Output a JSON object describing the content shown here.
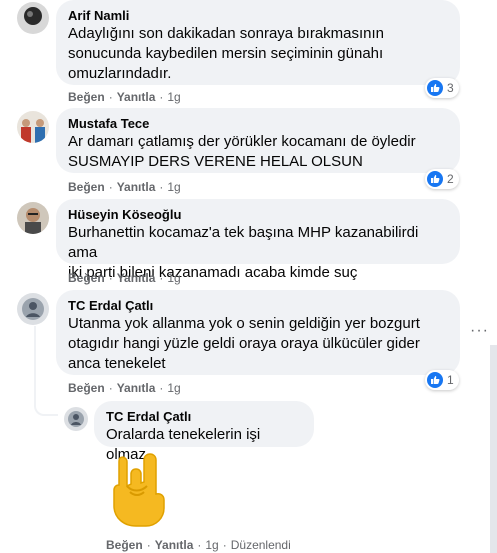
{
  "comments": [
    {
      "author": "Arif Namli",
      "text": "Adaylığını son dakikadan sonraya bırakmasının\nsonucunda kaybedilen mersin seçiminin günahı\nomuzlarındadır.",
      "like_label": "Beğen",
      "reply_label": "Yanıtla",
      "time": "1g",
      "reactions": "3"
    },
    {
      "author": "Mustafa Tece",
      "text": "Ar damarı çatlamış der yörükler kocamanı de öyledir\nSUSMAYIP DERS VERENE HELAL OLSUN",
      "like_label": "Beğen",
      "reply_label": "Yanıtla",
      "time": "1g",
      "reactions": "2"
    },
    {
      "author": "Hüseyin Köseoğlu",
      "text": "Burhanettin kocamaz'a tek başına MHP kazanabilirdi ama\niki parti bileni kazanamadı acaba kimde suç",
      "like_label": "Beğen",
      "reply_label": "Yanıtla",
      "time": "1g",
      "reactions": ""
    },
    {
      "author": "TC Erdal Çatlı",
      "text": "Utanma yok allanma yok o senin geldiğin yer bozgurt\notagıdır hangi yüzle geldi oraya oraya ülkücüler gider\nanca tenekelet",
      "like_label": "Beğen",
      "reply_label": "Yanıtla",
      "time": "1g",
      "reactions": "1"
    }
  ],
  "reply": {
    "author": "TC Erdal Çatlı",
    "text": "Oralarda tenekelerin işi olmaz",
    "sticker": "horns-hand-emoji",
    "like_label": "Beğen",
    "reply_label": "Yanıtla",
    "time": "1g",
    "edited_label": "Düzenlendi"
  },
  "colors": {
    "bubble": "#f0f2f5",
    "meta": "#65676b",
    "like": "#1877f2",
    "emoji": "#f5b921"
  }
}
